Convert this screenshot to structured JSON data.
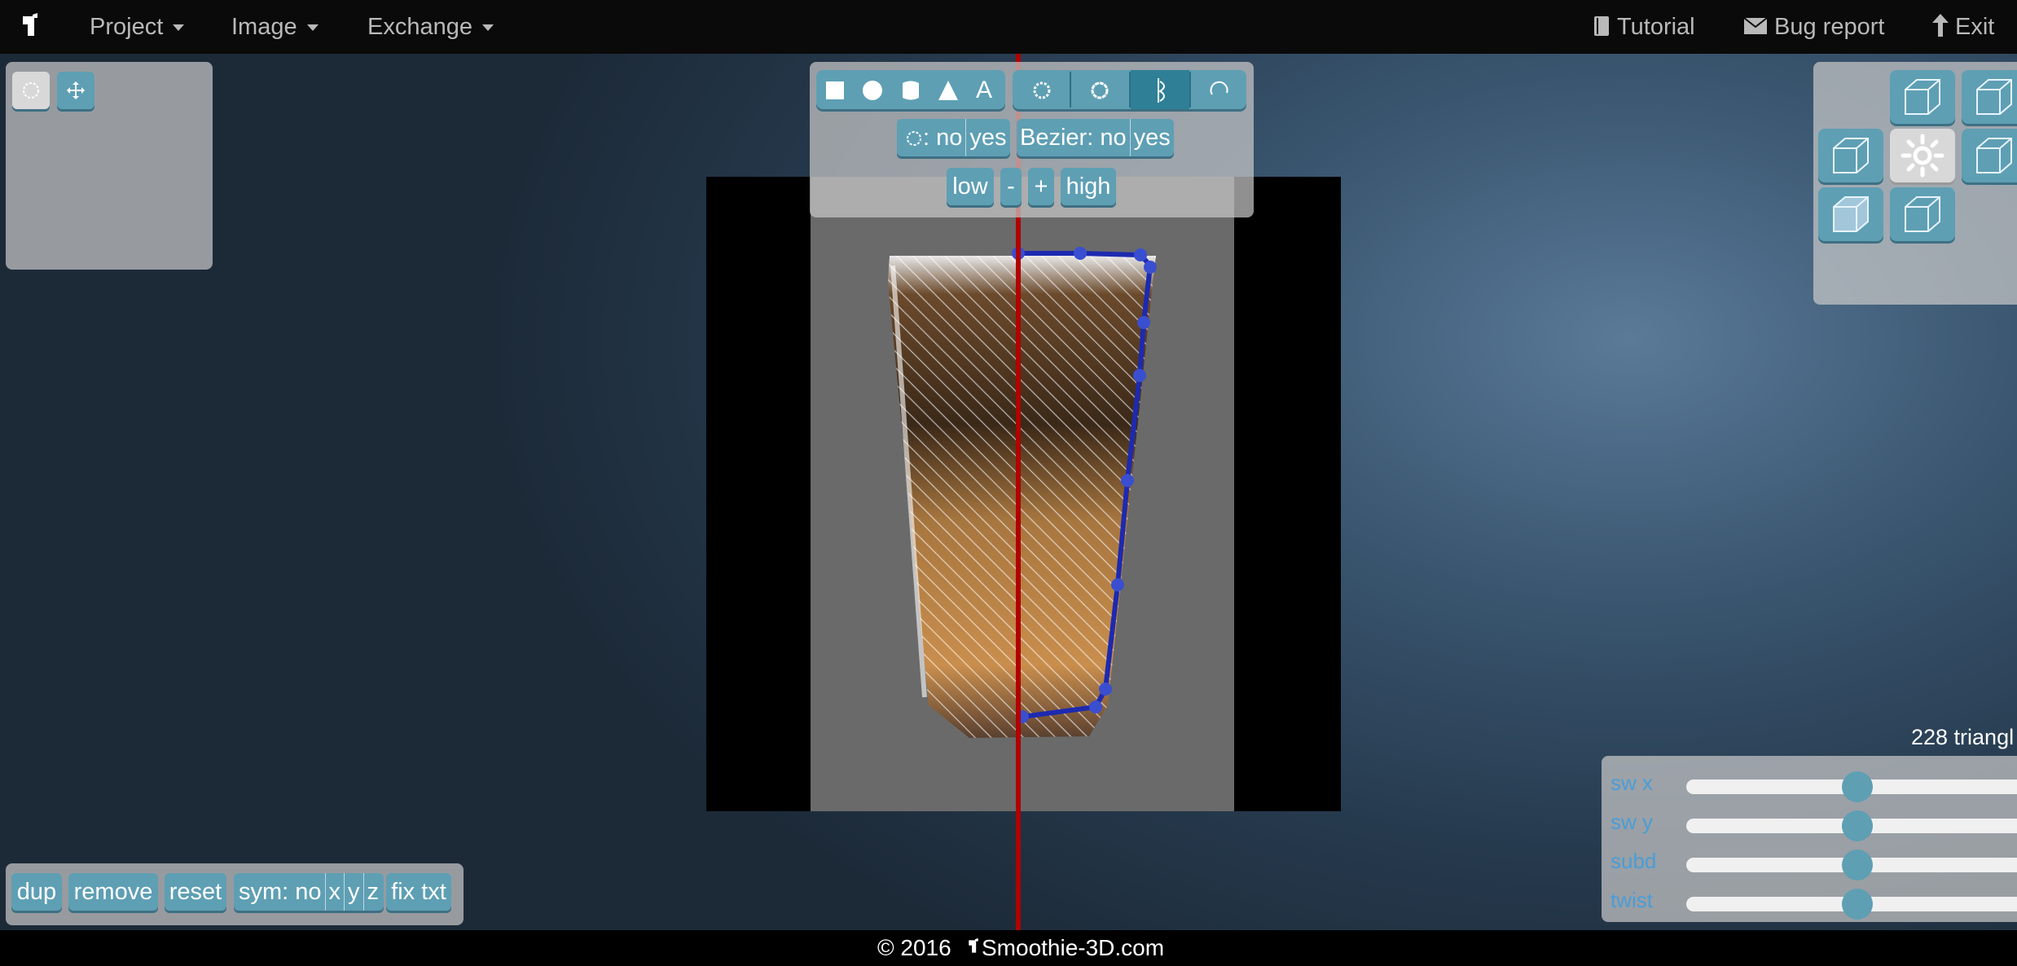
{
  "menu": {
    "project": "Project",
    "image": "Image",
    "exchange": "Exchange",
    "tutorial": "Tutorial",
    "bug_report": "Bug report",
    "exit": "Exit"
  },
  "shape_toolbar": {
    "text_tool": "A",
    "profile_label": ": no",
    "profile_yes": "yes",
    "bezier_label": "Bezier: no",
    "bezier_yes": "yes",
    "low": "low",
    "minus": "-",
    "plus": "+",
    "high": "high"
  },
  "bottom_toolbar": {
    "dup": "dup",
    "remove": "remove",
    "reset": "reset",
    "sym_no": "sym: no",
    "sym_x": "x",
    "sym_y": "y",
    "sym_z": "z",
    "fix_txt": "fix txt"
  },
  "stats": {
    "triangles": "228 triangl"
  },
  "sliders": [
    {
      "label": "sw x",
      "value": 0.5
    },
    {
      "label": "sw y",
      "value": 0.5
    },
    {
      "label": "subd",
      "value": 0.5
    },
    {
      "label": "twist",
      "value": 0.5
    }
  ],
  "footer": {
    "copyright": "© 2016",
    "site": "Smoothie-3D.com"
  },
  "colors": {
    "button": "#5e9fb4",
    "button_active": "#2f7f96",
    "outline": "#1d2ab0",
    "axis": "#b00000",
    "slider_label": "#4a9dd8"
  }
}
